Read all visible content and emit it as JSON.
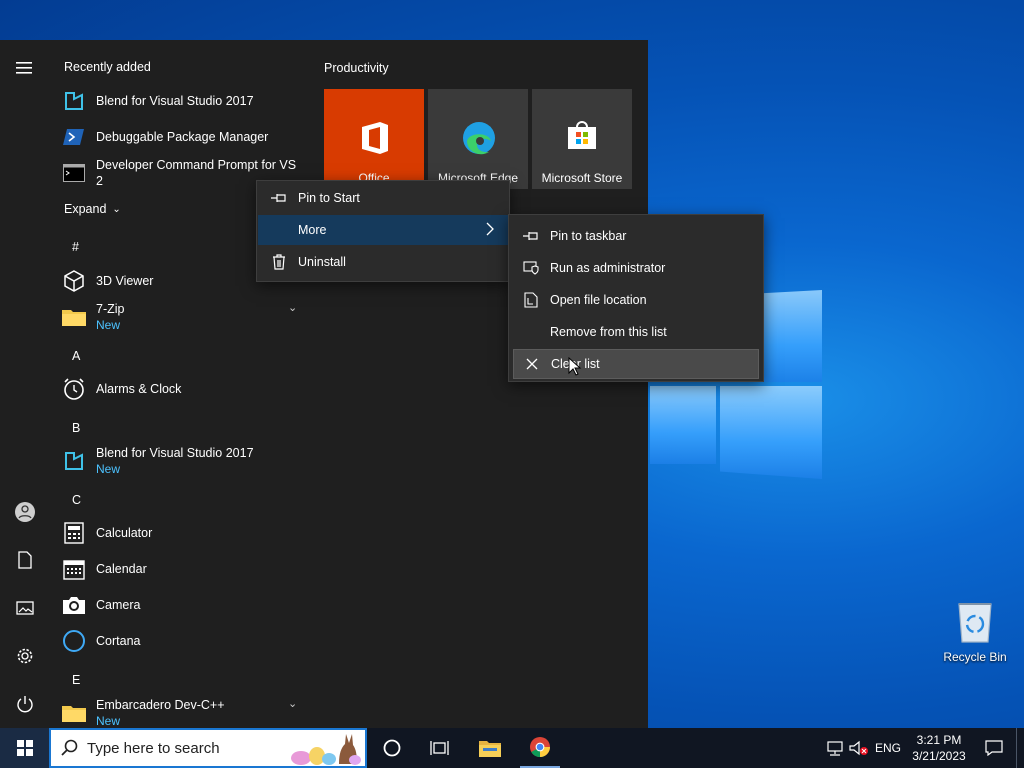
{
  "start": {
    "recent_title": "Recently added",
    "recent": [
      {
        "label": "Blend for Visual Studio 2017"
      },
      {
        "label": "Debuggable Package Manager"
      },
      {
        "label": "Developer Command Prompt for VS 2"
      }
    ],
    "expand_label": "Expand",
    "letters": [
      "#",
      "A",
      "B",
      "C",
      "E"
    ],
    "apps": [
      {
        "label": "3D Viewer"
      },
      {
        "label": "7-Zip",
        "sub": "New"
      },
      {
        "label": "Alarms & Clock"
      },
      {
        "label": "Blend for Visual Studio 2017",
        "sub": "New"
      },
      {
        "label": "Calculator"
      },
      {
        "label": "Calendar"
      },
      {
        "label": "Camera"
      },
      {
        "label": "Cortana"
      },
      {
        "label": "Embarcadero Dev-C++",
        "sub": "New"
      }
    ],
    "tiles_title": "Productivity",
    "tiles": [
      {
        "label": "Office",
        "color": "#d83b01"
      },
      {
        "label": "Microsoft Edge",
        "color": "#3a3a3a"
      },
      {
        "label": "Microsoft Store",
        "color": "#3a3a3a"
      }
    ]
  },
  "context_menu": {
    "items": [
      {
        "label": "Pin to Start",
        "icon": "pin-icon"
      },
      {
        "label": "More",
        "icon": "chevron-right-icon"
      },
      {
        "label": "Uninstall",
        "icon": "trash-icon"
      }
    ]
  },
  "submenu": {
    "items": [
      {
        "label": "Pin to taskbar",
        "icon": "pin-icon"
      },
      {
        "label": "Run as administrator",
        "icon": "shield-icon"
      },
      {
        "label": "Open file location",
        "icon": "folder-location-icon"
      },
      {
        "label": "Remove from this list",
        "icon": ""
      },
      {
        "label": "Clear list",
        "icon": "close-icon"
      }
    ]
  },
  "desktop": {
    "recycle_bin": "Recycle Bin"
  },
  "taskbar": {
    "search_placeholder": "Type here to search",
    "language": "ENG",
    "time": "3:21 PM",
    "date": "3/21/2023"
  },
  "colors": {
    "accent": "#0078d7",
    "new_badge": "#4cc2ff",
    "menu_bg": "#2b2b2b",
    "start_bg": "#1f1f1f"
  }
}
